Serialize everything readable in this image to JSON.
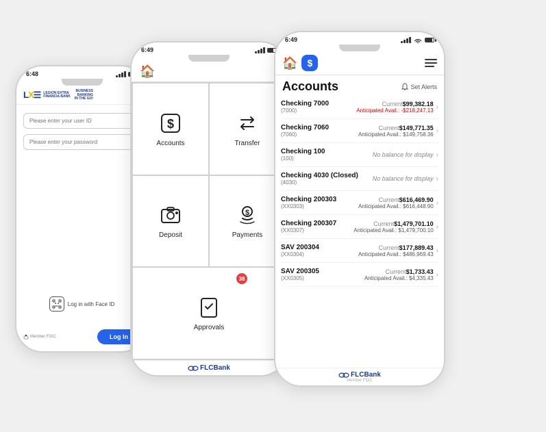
{
  "scene": {
    "bg_color": "#f0f0f0"
  },
  "phone1": {
    "status_time": "6:48",
    "logo_lx": "LX",
    "logo_subtitle": "LEGION EXTRA\nFINANCIA BANK",
    "logo_tagline": "BUSINESS\nBANKING\nIN THE GO!",
    "input_userid_placeholder": "Please enter your user ID",
    "input_password_placeholder": "Please enter your password",
    "face_id_label": "Log in with Face ID",
    "fdic_label": "Member FDIC",
    "login_button": "Log In"
  },
  "phone2": {
    "status_time": "6:49",
    "menu_items": [
      {
        "id": "accounts",
        "label": "Accounts",
        "icon": "dollar-box"
      },
      {
        "id": "transfer",
        "label": "Transfer",
        "icon": "transfer"
      },
      {
        "id": "deposit",
        "label": "Deposit",
        "icon": "camera"
      },
      {
        "id": "payments",
        "label": "Payments",
        "icon": "payments"
      },
      {
        "id": "approvals",
        "label": "Approvals",
        "icon": "approve",
        "badge": "38"
      }
    ],
    "footer_logo": "FLCBank"
  },
  "phone3": {
    "status_time": "6:49",
    "title": "Accounts",
    "set_alerts_label": "Set Alerts",
    "accounts": [
      {
        "name": "Checking 7000",
        "sub": "(7000)",
        "current_label": "Current",
        "current": "$99,382.18",
        "avail_label": "Anticipated Avail.:",
        "avail": "-$218,247.13",
        "avail_negative": true
      },
      {
        "name": "Checking 7060",
        "sub": "(7060)",
        "current_label": "Current",
        "current": "$149,771.35",
        "avail_label": "Anticipated Avail.:",
        "avail": "$149,758.36",
        "avail_negative": false
      },
      {
        "name": "Checking 100",
        "sub": "(100)",
        "current_label": "",
        "current": "",
        "avail_label": "No balance for display",
        "avail": "",
        "no_balance": true
      },
      {
        "name": "Checking 4030 (Closed)",
        "sub": "(4030)",
        "current_label": "",
        "current": "",
        "avail_label": "No balance for display",
        "avail": "",
        "no_balance": true
      },
      {
        "name": "Checking 200303",
        "sub": "(XX0303)",
        "current_label": "Current",
        "current": "$616,469.90",
        "avail_label": "Anticipated Avail.:",
        "avail": "$616,448.90",
        "avail_negative": false
      },
      {
        "name": "Checking 200307",
        "sub": "(XX0307)",
        "current_label": "Current",
        "current": "$1,479,701.10",
        "avail_label": "Anticipated Avail.:",
        "avail": "$1,479,700.10",
        "avail_negative": false
      },
      {
        "name": "SAV 200304",
        "sub": "(XX0304)",
        "current_label": "Current",
        "current": "$177,889.43",
        "avail_label": "Anticipated Avail.:",
        "avail": "$486,969.43",
        "avail_negative": false
      },
      {
        "name": "SAV 200305",
        "sub": "(XX0305)",
        "current_label": "Current",
        "current": "$1,733.43",
        "avail_label": "Anticipated Avail.:",
        "avail": "$4,335.43",
        "avail_negative": false
      }
    ],
    "footer_logo": "FLCBank",
    "member_fdic": "Member FDIC"
  }
}
